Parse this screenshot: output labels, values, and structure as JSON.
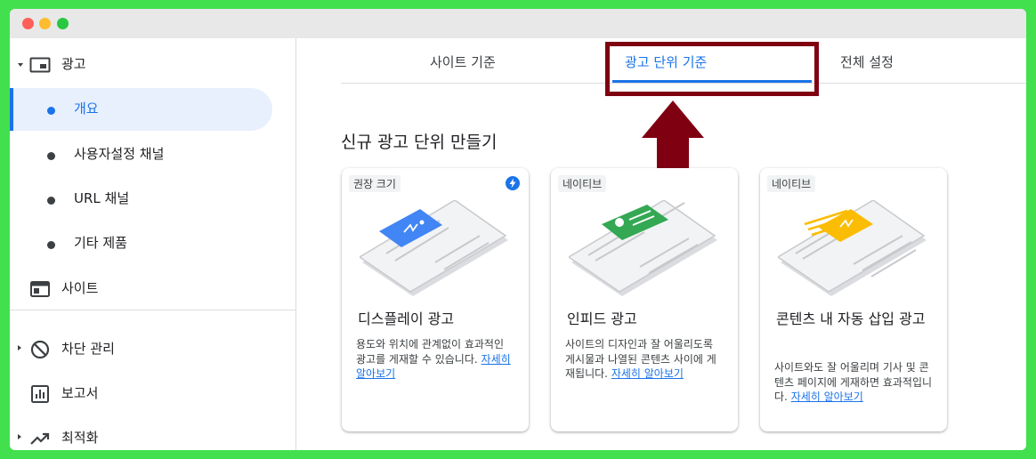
{
  "sidebar": {
    "ads": {
      "label": "광고"
    },
    "sub_items": [
      {
        "label": "개요"
      },
      {
        "label": "사용자설정 채널"
      },
      {
        "label": "URL 채널"
      },
      {
        "label": "기타 제품"
      }
    ],
    "sites": {
      "label": "사이트"
    },
    "blocking": {
      "label": "차단 관리"
    },
    "reports": {
      "label": "보고서"
    },
    "optimization": {
      "label": "최적화"
    }
  },
  "tabs": [
    {
      "label": "사이트 기준"
    },
    {
      "label": "광고 단위 기준"
    },
    {
      "label": "전체 설정"
    }
  ],
  "section_title": "신규 광고 단위 만들기",
  "cards": [
    {
      "badge": "권장 크기",
      "title": "디스플레이 광고",
      "desc": "용도와 위치에 관계없이 효과적인 광고를 게재할 수 있습니다.",
      "link": "자세히 알아보기"
    },
    {
      "badge": "네이티브",
      "title": "인피드 광고",
      "desc": "사이트의 디자인과 잘 어울리도록 게시물과 나열된 콘텐츠 사이에 게재됩니다.",
      "link": "자세히 알아보기"
    },
    {
      "badge": "네이티브",
      "title": "콘텐츠 내 자동 삽입 광고",
      "desc": "사이트와도 잘 어울리며 기사 및 콘텐츠 페이지에 게재하면 효과적입니다.",
      "link": "자세히 알아보기"
    }
  ],
  "colors": {
    "accent": "#1a73e8",
    "highlight": "#7f0011",
    "background": "#42e04f"
  }
}
